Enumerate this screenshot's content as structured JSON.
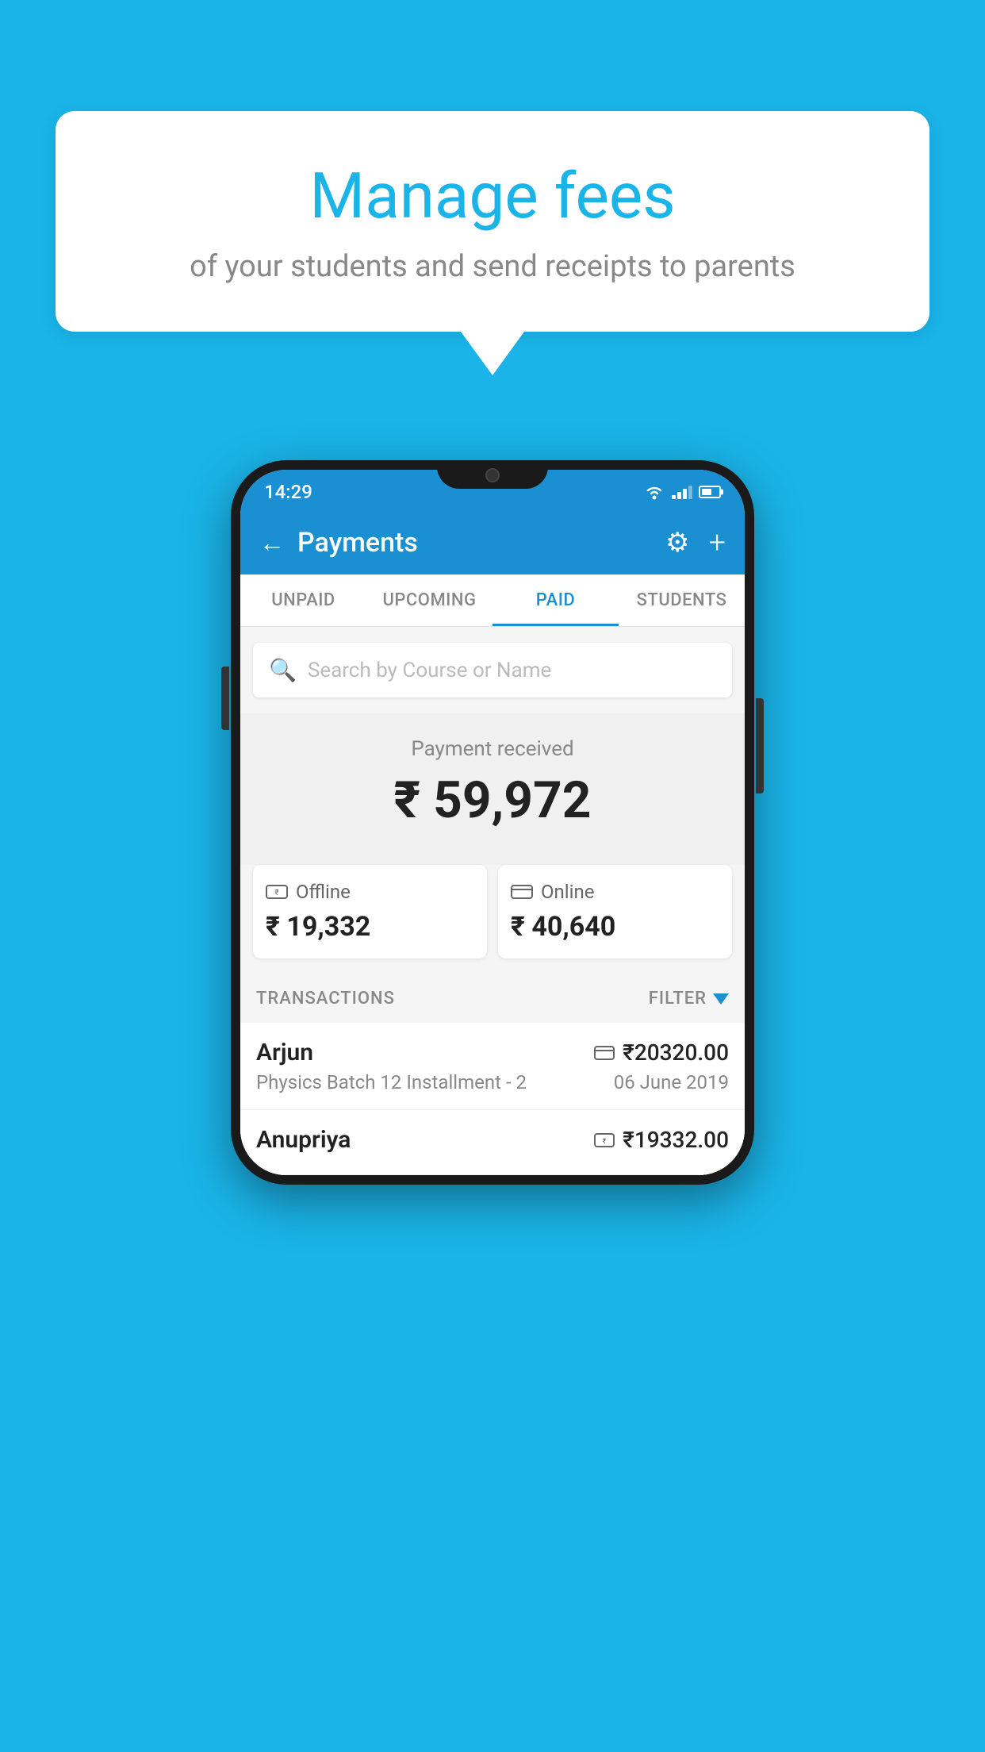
{
  "background_color": "#1ab4e8",
  "speech_bubble": {
    "title": "Manage fees",
    "subtitle": "of your students and send receipts to parents"
  },
  "status_bar": {
    "time": "14:29"
  },
  "header": {
    "title": "Payments",
    "back_label": "←",
    "gear_label": "⚙",
    "plus_label": "+"
  },
  "tabs": [
    {
      "label": "UNPAID",
      "active": false
    },
    {
      "label": "UPCOMING",
      "active": false
    },
    {
      "label": "PAID",
      "active": true
    },
    {
      "label": "STUDENTS",
      "active": false
    }
  ],
  "search": {
    "placeholder": "Search by Course or Name"
  },
  "payment_section": {
    "label": "Payment received",
    "total": "₹ 59,972",
    "offline_label": "Offline",
    "offline_amount": "₹ 19,332",
    "online_label": "Online",
    "online_amount": "₹ 40,640"
  },
  "transactions": {
    "header_label": "TRANSACTIONS",
    "filter_label": "FILTER",
    "items": [
      {
        "name": "Arjun",
        "amount": "₹20320.00",
        "payment_type": "online",
        "course": "Physics Batch 12 Installment - 2",
        "date": "06 June 2019"
      },
      {
        "name": "Anupriya",
        "amount": "₹19332.00",
        "payment_type": "offline",
        "course": "",
        "date": ""
      }
    ]
  }
}
